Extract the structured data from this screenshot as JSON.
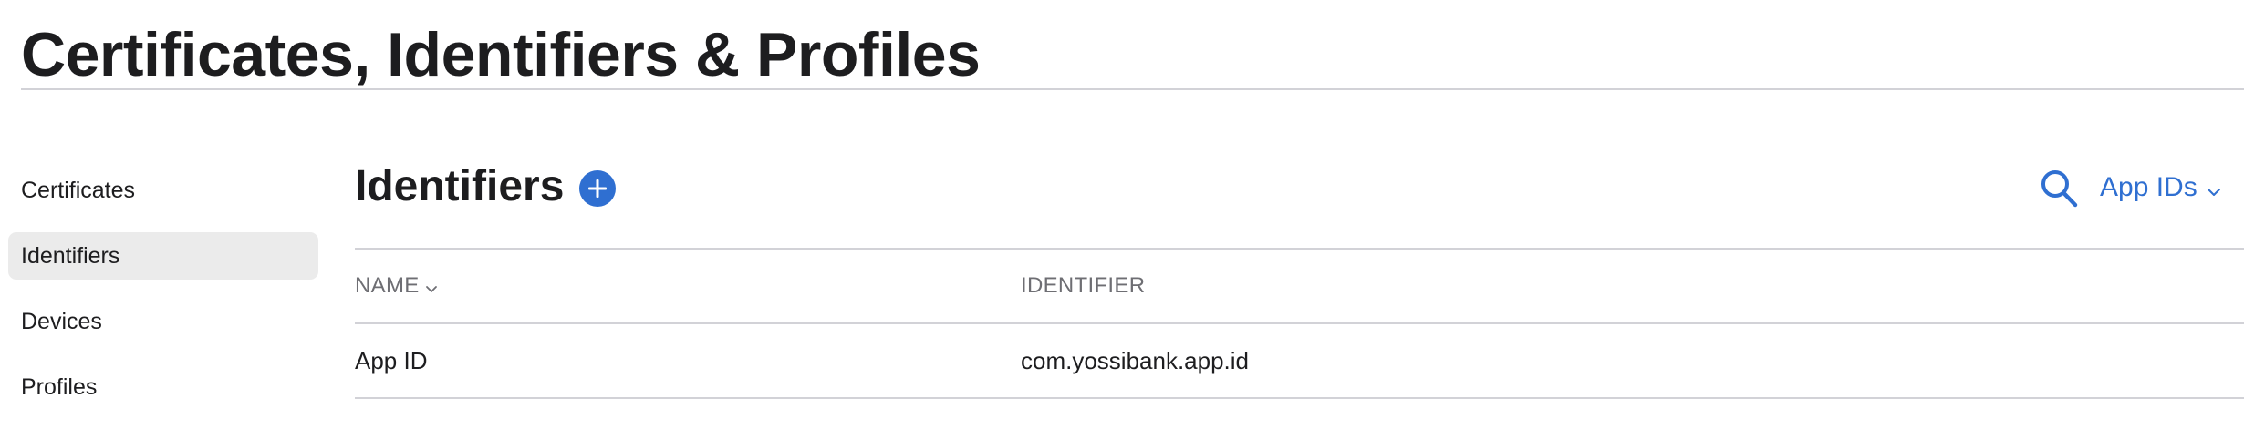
{
  "header": {
    "title": "Certificates, Identifiers & Profiles"
  },
  "sidebar": {
    "items": [
      {
        "label": "Certificates",
        "active": false
      },
      {
        "label": "Identifiers",
        "active": true
      },
      {
        "label": "Devices",
        "active": false
      },
      {
        "label": "Profiles",
        "active": false
      }
    ]
  },
  "main": {
    "title": "Identifiers",
    "add_icon": "plus-circle-icon",
    "search_icon": "search-icon",
    "filter": {
      "selected": "App IDs",
      "icon": "chevron-down-icon"
    },
    "table": {
      "columns": [
        {
          "label": "NAME",
          "sortable": true
        },
        {
          "label": "IDENTIFIER",
          "sortable": false
        }
      ],
      "rows": [
        {
          "name": "App ID",
          "identifier": "com.yossibank.app.id"
        }
      ]
    }
  },
  "colors": {
    "accent": "#2f6fd1",
    "text": "#1d1d1f",
    "secondary_text": "#6e6e73",
    "active_item_bg": "#ebebeb",
    "divider": "#d2d2d7"
  }
}
